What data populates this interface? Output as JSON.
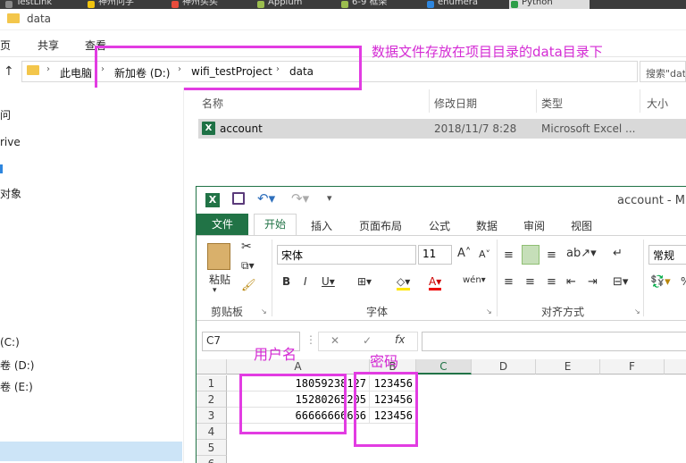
{
  "browser": {
    "tabs": [
      "TestLink",
      "神州问学",
      "神州买买",
      "Appium",
      "6-9 框架",
      "enumera",
      "Python"
    ]
  },
  "explorer": {
    "title": "data",
    "ribbon_tabs": [
      "页",
      "共享",
      "查看"
    ],
    "breadcrumb": [
      "此电脑",
      "新加卷 (D:)",
      "wifi_testProject",
      "data"
    ],
    "search_placeholder": "搜索\"data",
    "annotation": "数据文件存放在项目目录的data目录下",
    "nav_items": [
      "问",
      "rive",
      "对象",
      "(C:)",
      "卷 (D:)",
      "卷 (E:)"
    ],
    "columns": [
      "名称",
      "修改日期",
      "类型",
      "大小"
    ],
    "files": [
      {
        "name": "account",
        "modified": "2018/11/7 8:28",
        "type": "Microsoft Excel ..."
      }
    ]
  },
  "excel": {
    "title": "account - Mic",
    "tabs": [
      "文件",
      "开始",
      "插入",
      "页面布局",
      "公式",
      "数据",
      "审阅",
      "视图"
    ],
    "paste_label": "粘贴",
    "font_name": "宋体",
    "font_size": "11",
    "number_format": "常规",
    "groups": [
      "剪贴板",
      "字体",
      "对齐方式"
    ],
    "name_box": "C7",
    "fx": "fx",
    "columns": [
      "A",
      "B",
      "C",
      "D",
      "E",
      "F"
    ],
    "rows": [
      "1",
      "2",
      "3",
      "4",
      "5",
      "6"
    ],
    "cells": [
      [
        "18059238127",
        "123456"
      ],
      [
        "15280265205",
        "123456"
      ],
      [
        "66666666666",
        "123456"
      ]
    ],
    "label_username": "用户名",
    "label_password": "密码"
  },
  "colors": {
    "excel_green": "#217346",
    "annotation": "#e23ce2"
  }
}
